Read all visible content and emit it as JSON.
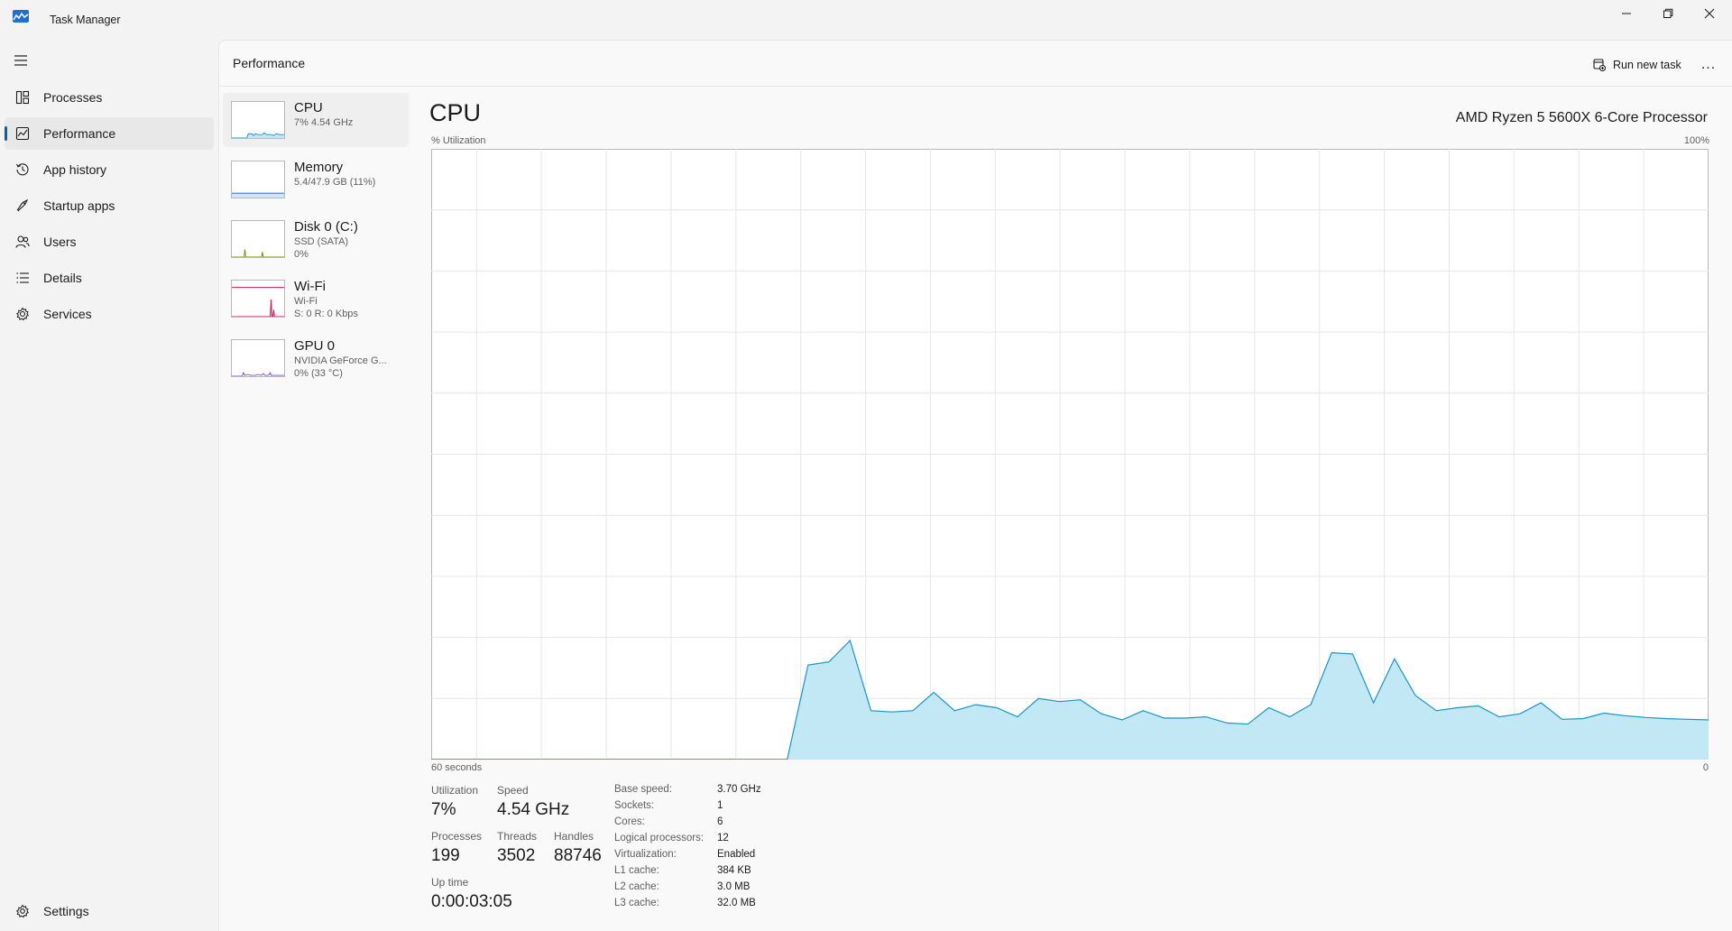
{
  "window": {
    "title": "Task Manager"
  },
  "nav": {
    "items": [
      {
        "label": "Processes",
        "icon": "processes-icon"
      },
      {
        "label": "Performance",
        "icon": "performance-icon",
        "active": true
      },
      {
        "label": "App history",
        "icon": "history-icon"
      },
      {
        "label": "Startup apps",
        "icon": "startup-icon"
      },
      {
        "label": "Users",
        "icon": "users-icon"
      },
      {
        "label": "Details",
        "icon": "details-icon"
      },
      {
        "label": "Services",
        "icon": "services-icon"
      }
    ],
    "settings_label": "Settings"
  },
  "header": {
    "title": "Performance",
    "run_new_task": "Run new task",
    "more": "..."
  },
  "devices": [
    {
      "title": "CPU",
      "line1": "7% 4.54 GHz",
      "line2": "",
      "color": "#1a95c5"
    },
    {
      "title": "Memory",
      "line1": "5.4/47.9 GB (11%)",
      "line2": "",
      "color": "#3b7bd5"
    },
    {
      "title": "Disk 0 (C:)",
      "line1": "SSD (SATA)",
      "line2": "0%",
      "color": "#6f8a16"
    },
    {
      "title": "Wi-Fi",
      "line1": "Wi-Fi",
      "line2": "S: 0 R: 0 Kbps",
      "color": "#c4155f"
    },
    {
      "title": "GPU 0",
      "line1": "NVIDIA GeForce G...",
      "line2": "0% (33 °C)",
      "color": "#7a4fd6"
    }
  ],
  "cpu": {
    "title": "CPU",
    "model": "AMD Ryzen 5 5600X 6-Core Processor",
    "axis_top_left": "% Utilization",
    "axis_top_right": "100%",
    "axis_bottom_left": "60 seconds",
    "axis_bottom_right": "0",
    "stats": {
      "utilization_label": "Utilization",
      "utilization": "7%",
      "speed_label": "Speed",
      "speed": "4.54 GHz",
      "processes_label": "Processes",
      "processes": "199",
      "threads_label": "Threads",
      "threads": "3502",
      "handles_label": "Handles",
      "handles": "88746",
      "uptime_label": "Up time",
      "uptime": "0:00:03:05"
    },
    "specs": [
      {
        "label": "Base speed:",
        "value": "3.70 GHz"
      },
      {
        "label": "Sockets:",
        "value": "1"
      },
      {
        "label": "Cores:",
        "value": "6"
      },
      {
        "label": "Logical processors:",
        "value": "12"
      },
      {
        "label": "Virtualization:",
        "value": "Enabled"
      },
      {
        "label": "L1 cache:",
        "value": "384 KB"
      },
      {
        "label": "L2 cache:",
        "value": "3.0 MB"
      },
      {
        "label": "L3 cache:",
        "value": "32.0 MB"
      }
    ]
  },
  "chart_data": {
    "type": "area",
    "xlabel": "60 seconds",
    "ylabel": "% Utilization",
    "xlim": [
      60,
      0
    ],
    "ylim": [
      0,
      100
    ],
    "grid": true,
    "color": "#1a95c5",
    "fill": "#c2e8f6",
    "x": [
      60,
      59,
      58,
      57,
      58,
      56,
      55,
      54,
      53,
      52,
      51,
      50,
      49,
      48,
      47,
      46,
      45,
      44,
      43,
      42,
      41,
      40,
      39,
      38,
      37,
      36,
      35,
      34,
      33,
      32,
      31,
      30,
      29,
      28,
      27,
      26,
      25,
      24,
      23,
      22,
      21,
      20,
      19,
      18,
      17,
      16,
      15,
      14,
      13,
      12,
      11,
      10,
      9,
      8,
      7,
      6,
      5,
      4,
      3,
      2,
      1,
      0
    ],
    "series": [
      {
        "values": [
          0,
          0,
          0,
          0,
          0,
          0,
          0,
          0,
          0,
          0,
          0,
          0,
          0,
          0,
          0,
          0,
          0,
          0,
          15.5,
          16,
          19.5,
          8,
          7.8,
          8,
          11,
          8,
          9,
          8.5,
          7,
          10,
          9.5,
          9.8,
          7.5,
          6.5,
          8,
          6.8,
          6.8,
          7,
          6,
          5.8,
          8.5,
          7,
          9,
          17.5,
          17.3,
          9.3,
          16.5,
          10.5,
          8,
          8.5,
          8.8,
          7,
          7.5,
          9.3,
          6.6,
          6.7,
          7.6,
          7.2,
          6.9,
          6.7,
          6.6,
          6.5
        ]
      }
    ]
  }
}
